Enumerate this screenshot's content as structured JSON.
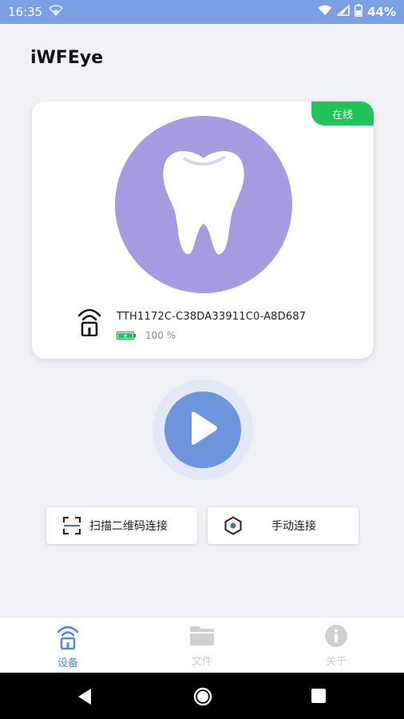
{
  "status_bar": {
    "time": "16:35",
    "battery_text": "44%",
    "icons": [
      "wifi-icon",
      "signal-icon",
      "battery-icon"
    ]
  },
  "app": {
    "title": "iWFEye"
  },
  "device_card": {
    "status_badge": "在线",
    "device_id": "TTH1172C-C38DA33911C0-A8D687",
    "battery_percent": "100 %",
    "battery_level": 1.0,
    "image_icon": "tooth-icon",
    "colors": {
      "circle": "#a49be0",
      "badge": "#21c45a"
    }
  },
  "play_button": {
    "icon": "play-icon",
    "color": "#6d95de"
  },
  "actions": {
    "scan_label": "扫描二维码连接",
    "manual_label": "手动连接"
  },
  "bottom_nav": {
    "items": [
      {
        "label": "设备",
        "icon": "device-icon",
        "active": true
      },
      {
        "label": "文件",
        "icon": "folder-icon",
        "active": false
      },
      {
        "label": "关于",
        "icon": "info-icon",
        "active": false
      }
    ],
    "active_color": "#5a86d8"
  },
  "system_nav": {
    "icons": [
      "back-icon",
      "home-icon",
      "recent-apps-icon"
    ]
  }
}
